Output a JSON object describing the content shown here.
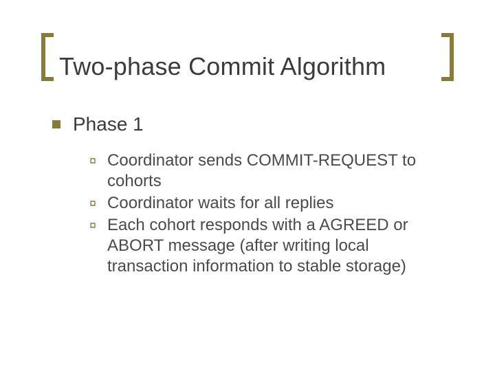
{
  "title": "Two-phase Commit Algorithm",
  "phase": {
    "heading": "Phase 1",
    "items": [
      "Coordinator sends COMMIT-REQUEST to cohorts",
      "Coordinator waits for all replies",
      "Each cohort responds with a AGREED or ABORT message (after writing local transaction information to stable storage)"
    ]
  }
}
